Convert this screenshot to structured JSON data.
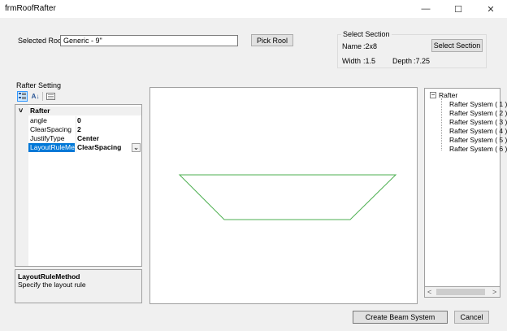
{
  "window": {
    "title": "frmRoofRafter",
    "minimize_glyph": "—",
    "maximize_glyph": "☐",
    "close_glyph": "✕"
  },
  "selected_roof": {
    "label": "Selected Roof",
    "value": "Generic - 9\"",
    "pick_button": "Pick Rool"
  },
  "select_section": {
    "group_title": "Select Section",
    "name_label": "Name",
    "name_value": ":2x8",
    "width_label": "Width",
    "width_value": ":1.5",
    "depth_label": "Depth",
    "depth_value": ":7.25",
    "button": "Select Section"
  },
  "rafter_setting": {
    "group_title": "Rafter Setting",
    "toolbar": {
      "categorized_icon": "categorized-icon",
      "alphabetical_icon": "sort-az-icon",
      "alphabetical_glyph": "A↓",
      "pages_icon": "property-pages-icon"
    },
    "category": "Rafter",
    "category_toggle": "˅",
    "properties": [
      {
        "name": "angle",
        "value": "0"
      },
      {
        "name": "ClearSpacing",
        "value": "2"
      },
      {
        "name": "JustifyType",
        "value": "Center"
      },
      {
        "name": "LayoutRuleMeth",
        "value": "ClearSpacing"
      }
    ],
    "dropdown_glyph": "⌄",
    "description_title": "LayoutRuleMethod",
    "description_text": "Specify the layout rule"
  },
  "tree": {
    "root": "Rafter",
    "root_toggle": "−",
    "items": [
      "Rafter System ( 1 )",
      "Rafter System ( 2 )",
      "Rafter System ( 3 )",
      "Rafter System ( 4 )",
      "Rafter System ( 5 )",
      "Rafter System ( 6 )"
    ],
    "scroll_left": "<",
    "scroll_right": ">"
  },
  "footer": {
    "create_button": "Create Beam System",
    "cancel_button": "Cancel"
  },
  "colors": {
    "roof_outline": "#4caf50",
    "selection": "#0078d7",
    "window_bg": "#f0f0f0"
  }
}
